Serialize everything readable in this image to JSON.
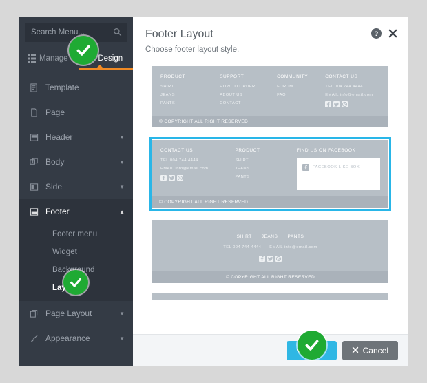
{
  "sidebar": {
    "search": {
      "placeholder": "Search Menu...",
      "value": "",
      "icon": "search-icon"
    },
    "tabs": [
      {
        "label": "Manage",
        "icon": "grid-icon",
        "active": false
      },
      {
        "label": "Design",
        "icon": "brush-icon",
        "active": true
      }
    ],
    "items": [
      {
        "label": "Template",
        "icon": "template-icon",
        "caret": ""
      },
      {
        "label": "Page",
        "icon": "page-icon",
        "caret": ""
      },
      {
        "label": "Header",
        "icon": "header-icon",
        "caret": "▼"
      },
      {
        "label": "Body",
        "icon": "body-icon",
        "caret": "▼"
      },
      {
        "label": "Side",
        "icon": "side-icon",
        "caret": "▼"
      },
      {
        "label": "Footer",
        "icon": "footer-icon",
        "caret": "▲"
      }
    ],
    "footer_subitems": [
      {
        "label": "Footer menu",
        "active": false
      },
      {
        "label": "Widget",
        "active": false
      },
      {
        "label": "Background",
        "active": false
      },
      {
        "label": "Layout",
        "active": true
      }
    ],
    "items_after": [
      {
        "label": "Page Layout",
        "icon": "pagelayout-icon",
        "caret": "▼"
      },
      {
        "label": "Appearance",
        "icon": "brush-icon",
        "caret": "▼"
      }
    ]
  },
  "dialog": {
    "title": "Footer Layout",
    "subtitle": "Choose footer layout style.",
    "help_icon": "help-icon",
    "close_icon": "close-icon",
    "save_label": "Save",
    "cancel_label": "Cancel",
    "accent_color": "#29b6e8",
    "save_color": "#2fb7e4",
    "cancel_color": "#6e7479"
  },
  "layouts": [
    {
      "id": "layout-4col",
      "selected": false,
      "style": "columns",
      "columns": [
        {
          "heading": "PRODUCT",
          "links": [
            "SHIRT",
            "JEANS",
            "PANTS"
          ]
        },
        {
          "heading": "SUPPORT",
          "links": [
            "HOW TO ORDER",
            "ABOUT US",
            "CONTACT"
          ]
        },
        {
          "heading": "COMMUNITY",
          "links": [
            "FORUM",
            "FAQ"
          ]
        },
        {
          "heading": "CONTACT US",
          "links": [
            "TEL 004 744 4444",
            "EMAIL info@email.com"
          ],
          "socials": [
            "facebook-icon",
            "twitter-icon",
            "googleplus-icon"
          ]
        }
      ],
      "copyright": "© COPYRIGHT ALL RIGHT RESERVED"
    },
    {
      "id": "layout-contact-facebook",
      "selected": true,
      "style": "columns-facebook",
      "columns": [
        {
          "heading": "CONTACT US",
          "links": [
            "TEL 004 744 4444",
            "EMAIL info@email.com"
          ],
          "socials": [
            "facebook-icon",
            "twitter-icon",
            "googleplus-icon"
          ]
        },
        {
          "heading": "PRODUCT",
          "links": [
            "SHIRT",
            "JEANS",
            "PANTS"
          ]
        },
        {
          "heading": "FIND US ON FACEBOOK",
          "facebook_box_label": "FACEBOOK LIKE BOX"
        }
      ],
      "copyright": "© COPYRIGHT ALL RIGHT RESERVED"
    },
    {
      "id": "layout-centered",
      "selected": false,
      "style": "centered",
      "links": [
        "SHIRT",
        "JEANS",
        "PANTS"
      ],
      "contact": [
        "TEL 004 744-4444",
        "EMAIL info@email.com"
      ],
      "socials": [
        "facebook-icon",
        "twitter-icon",
        "googleplus-icon"
      ],
      "copyright": "© COPYRIGHT ALL RIGHT RESERVED"
    },
    {
      "id": "layout-partial",
      "selected": false,
      "style": "teaser"
    }
  ],
  "overlays": [
    {
      "id": "check-design",
      "icon": "check-icon",
      "color": "#1faa33"
    },
    {
      "id": "check-layout",
      "icon": "check-icon",
      "color": "#1faa33"
    },
    {
      "id": "check-save",
      "icon": "check-icon",
      "color": "#1faa33"
    }
  ]
}
